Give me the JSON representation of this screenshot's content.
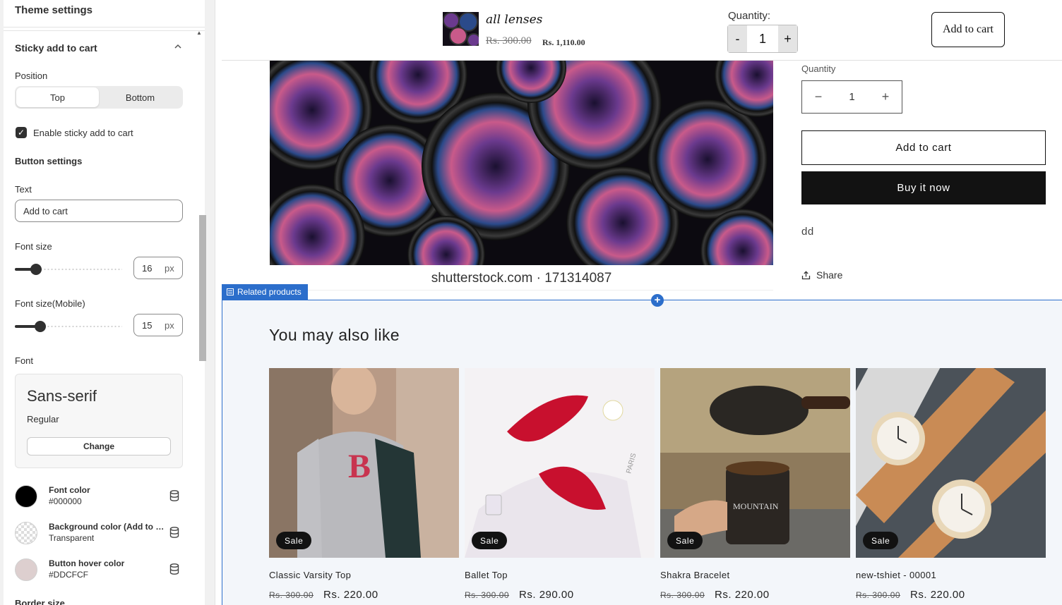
{
  "panel": {
    "header": "Theme settings",
    "section_title": "Sticky add to cart",
    "position": {
      "label": "Position",
      "options": [
        "Top",
        "Bottom"
      ],
      "selected": "Top"
    },
    "enable": {
      "label": "Enable sticky add to cart",
      "checked": true
    },
    "button_settings_label": "Button settings",
    "text": {
      "label": "Text",
      "value": "Add to cart"
    },
    "font_size": {
      "label": "Font size",
      "value": "16",
      "unit": "px",
      "level": 0.2
    },
    "font_size_mobile": {
      "label": "Font size(Mobile)",
      "value": "15",
      "unit": "px",
      "level": 0.24
    },
    "font": {
      "label": "Font",
      "name": "Sans-serif",
      "style": "Regular",
      "change_label": "Change"
    },
    "colors": [
      {
        "name": "Font color",
        "value": "#000000",
        "swatch": "#000000"
      },
      {
        "name": "Background color (Add to cart)",
        "value": "Transparent",
        "swatch": "transparent"
      },
      {
        "name": "Button hover color",
        "value": "#DDCFCF",
        "swatch": "#DDCFCF"
      }
    ],
    "partial_label": "Border size"
  },
  "sticky_bar": {
    "product_title": "all lenses",
    "old_price": "Rs. 300.00",
    "new_price": "Rs. 1,110.00",
    "quantity_label": "Quantity:",
    "minus": "-",
    "plus": "+",
    "quantity": "1",
    "button": "Add to cart"
  },
  "product": {
    "image_caption": "shutterstock.com · 171314087",
    "quantity_label": "Quantity",
    "minus": "−",
    "plus": "+",
    "quantity": "1",
    "add_to_cart": "Add to cart",
    "buy_now": "Buy it now",
    "description": "dd",
    "share": "Share"
  },
  "section_tag": "Related products",
  "related": {
    "title": "You may also like",
    "products": [
      {
        "name": "Classic Varsity Top",
        "old": "Rs. 300.00",
        "price": "Rs. 220.00",
        "badge": "Sale"
      },
      {
        "name": "Ballet Top",
        "old": "Rs. 300.00",
        "price": "Rs. 290.00",
        "badge": "Sale"
      },
      {
        "name": "Shakra Bracelet",
        "old": "Rs. 300.00",
        "price": "Rs. 220.00",
        "badge": "Sale"
      },
      {
        "name": "new-tshiet - 00001",
        "old": "Rs. 300.00",
        "price": "Rs. 220.00",
        "badge": "Sale"
      }
    ]
  },
  "colors": {
    "accent": "#2c6ecb",
    "dark": "#121212",
    "panel_bg": "#f1f1f1"
  }
}
